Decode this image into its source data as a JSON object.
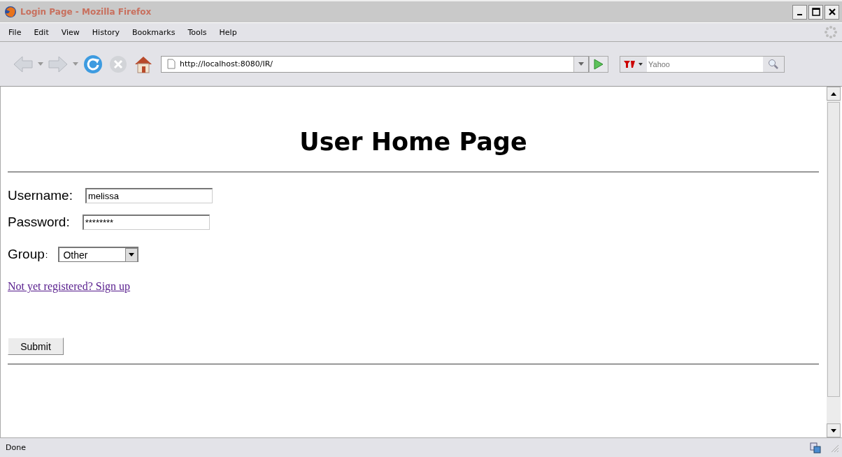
{
  "window": {
    "title": "Login Page - Mozilla Firefox"
  },
  "menu": [
    "File",
    "Edit",
    "View",
    "History",
    "Bookmarks",
    "Tools",
    "Help"
  ],
  "address": {
    "value": "http://localhost:8080/IR/"
  },
  "search": {
    "placeholder": "Yahoo"
  },
  "page": {
    "heading": "User Home Page",
    "fields": [
      {
        "label": "Username:",
        "value": "melissa",
        "kind": "text"
      },
      {
        "label": "Password:",
        "value": "********",
        "kind": "text"
      }
    ],
    "group": {
      "label": "Group",
      "colon": ":",
      "value": "Other"
    },
    "link": "Not yet registered? Sign up",
    "submit": "Submit"
  },
  "status_bar": "Done"
}
